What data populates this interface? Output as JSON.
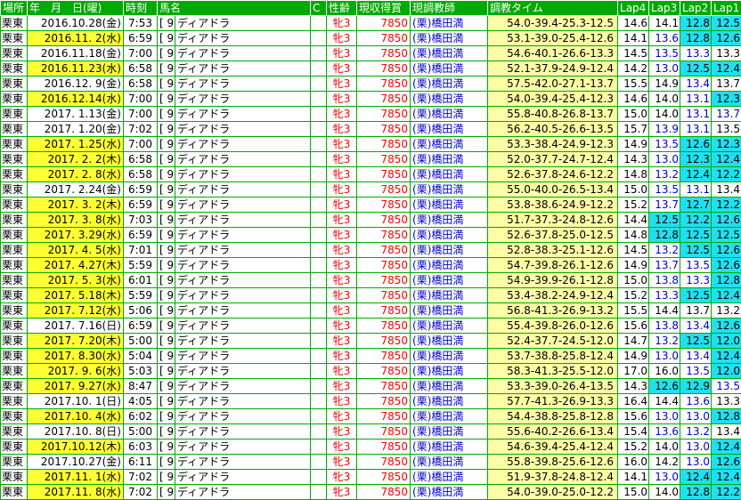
{
  "headers": {
    "place": "場所",
    "date": "年　月　日(曜)",
    "time": "時刻",
    "horse": "馬名",
    "c": "C",
    "sex_age": "性齢",
    "prize": "現収得賞",
    "trainer": "現調教師",
    "train_time": "調教タイム",
    "lap4": "Lap4",
    "lap3": "Lap3",
    "lap2": "Lap2",
    "lap1": "Lap1"
  },
  "colors": {
    "header_bg": "#00aa00",
    "weekday_highlight": "#ffff33",
    "lap_highlight": "#20e0f0",
    "train_bg": "#fdfca7",
    "red_text": "#ff0000",
    "blue_text": "#0000cc"
  },
  "rows": [
    {
      "place": "栗東",
      "date": "2016.10.28(金)",
      "date_hl": false,
      "time": "7:53",
      "num": "[ 9]",
      "horse": "ディアドラ",
      "sex": "牝3",
      "prize": "7850",
      "trainer": "(栗)橋田満",
      "train": "54.0-39.4-25.3-12.5",
      "lap4": "14.6",
      "lap3": "14.1",
      "lap2": "12.8",
      "lap1": "12.5",
      "hl4": false,
      "hl3": false,
      "hl2": true,
      "hl1": true,
      "b4": false,
      "b3": false,
      "b2": false,
      "b1": false
    },
    {
      "place": "栗東",
      "date": "2016.11. 2(水)",
      "date_hl": true,
      "time": "6:59",
      "num": "[ 9]",
      "horse": "ディアドラ",
      "sex": "牝3",
      "prize": "7850",
      "trainer": "(栗)橋田満",
      "train": "53.1-39.0-25.4-12.6",
      "lap4": "14.1",
      "lap3": "13.6",
      "lap2": "12.8",
      "lap1": "12.6",
      "hl4": false,
      "hl3": false,
      "hl2": true,
      "hl1": true,
      "b4": false,
      "b3": true,
      "b2": false,
      "b1": false
    },
    {
      "place": "栗東",
      "date": "2016.11.18(金)",
      "date_hl": false,
      "time": "7:00",
      "num": "[ 9]",
      "horse": "ディアドラ",
      "sex": "牝3",
      "prize": "7850",
      "trainer": "(栗)橋田満",
      "train": "54.6-40.1-26.6-13.3",
      "lap4": "14.5",
      "lap3": "13.5",
      "lap2": "13.3",
      "lap1": "13.3",
      "hl4": false,
      "hl3": false,
      "hl2": false,
      "hl1": false,
      "b4": false,
      "b3": true,
      "b2": true,
      "b1": false
    },
    {
      "place": "栗東",
      "date": "2016.11.23(水)",
      "date_hl": true,
      "time": "6:58",
      "num": "[ 9]",
      "horse": "ディアドラ",
      "sex": "牝3",
      "prize": "7850",
      "trainer": "(栗)橋田満",
      "train": "52.1-37.9-24.9-12.4",
      "lap4": "14.2",
      "lap3": "13.0",
      "lap2": "12.5",
      "lap1": "12.4",
      "hl4": false,
      "hl3": false,
      "hl2": true,
      "hl1": true,
      "b4": false,
      "b3": true,
      "b2": false,
      "b1": false
    },
    {
      "place": "栗東",
      "date": "2016.12. 9(金)",
      "date_hl": false,
      "time": "6:58",
      "num": "[ 9]",
      "horse": "ディアドラ",
      "sex": "牝3",
      "prize": "7850",
      "trainer": "(栗)橋田満",
      "train": "57.5-42.0-27.1-13.7",
      "lap4": "15.5",
      "lap3": "14.9",
      "lap2": "13.4",
      "lap1": "13.7",
      "hl4": false,
      "hl3": false,
      "hl2": false,
      "hl1": false,
      "b4": false,
      "b3": false,
      "b2": true,
      "b1": false
    },
    {
      "place": "栗東",
      "date": "2016.12.14(水)",
      "date_hl": true,
      "time": "7:00",
      "num": "[ 9]",
      "horse": "ディアドラ",
      "sex": "牝3",
      "prize": "7850",
      "trainer": "(栗)橋田満",
      "train": "54.0-39.4-25.4-12.3",
      "lap4": "14.6",
      "lap3": "14.0",
      "lap2": "13.1",
      "lap1": "12.3",
      "hl4": false,
      "hl3": false,
      "hl2": false,
      "hl1": true,
      "b4": false,
      "b3": false,
      "b2": true,
      "b1": false
    },
    {
      "place": "栗東",
      "date": "2017. 1.13(金)",
      "date_hl": false,
      "time": "7:00",
      "num": "[ 9]",
      "horse": "ディアドラ",
      "sex": "牝3",
      "prize": "7850",
      "trainer": "(栗)橋田満",
      "train": "55.8-40.8-26.8-13.7",
      "lap4": "15.0",
      "lap3": "14.0",
      "lap2": "13.1",
      "lap1": "13.7",
      "hl4": false,
      "hl3": false,
      "hl2": false,
      "hl1": false,
      "b4": false,
      "b3": false,
      "b2": true,
      "b1": true
    },
    {
      "place": "栗東",
      "date": "2017. 1.20(金)",
      "date_hl": false,
      "time": "7:02",
      "num": "[ 9]",
      "horse": "ディアドラ",
      "sex": "牝3",
      "prize": "7850",
      "trainer": "(栗)橋田満",
      "train": "56.2-40.5-26.6-13.5",
      "lap4": "15.7",
      "lap3": "13.9",
      "lap2": "13.1",
      "lap1": "13.5",
      "hl4": false,
      "hl3": false,
      "hl2": false,
      "hl1": false,
      "b4": false,
      "b3": true,
      "b2": true,
      "b1": false
    },
    {
      "place": "栗東",
      "date": "2017. 1.25(水)",
      "date_hl": true,
      "time": "7:00",
      "num": "[ 9]",
      "horse": "ディアドラ",
      "sex": "牝3",
      "prize": "7850",
      "trainer": "(栗)橋田満",
      "train": "53.3-38.4-24.9-12.3",
      "lap4": "14.9",
      "lap3": "13.5",
      "lap2": "12.6",
      "lap1": "12.3",
      "hl4": false,
      "hl3": false,
      "hl2": true,
      "hl1": true,
      "b4": false,
      "b3": true,
      "b2": false,
      "b1": false
    },
    {
      "place": "栗東",
      "date": "2017. 2. 2(木)",
      "date_hl": true,
      "time": "6:58",
      "num": "[ 9]",
      "horse": "ディアドラ",
      "sex": "牝3",
      "prize": "7850",
      "trainer": "(栗)橋田満",
      "train": "52.0-37.7-24.7-12.4",
      "lap4": "14.3",
      "lap3": "13.0",
      "lap2": "12.3",
      "lap1": "12.4",
      "hl4": false,
      "hl3": false,
      "hl2": true,
      "hl1": true,
      "b4": false,
      "b3": true,
      "b2": false,
      "b1": false
    },
    {
      "place": "栗東",
      "date": "2017. 2. 8(水)",
      "date_hl": true,
      "time": "6:58",
      "num": "[ 9]",
      "horse": "ディアドラ",
      "sex": "牝3",
      "prize": "7850",
      "trainer": "(栗)橋田満",
      "train": "52.6-37.8-24.6-12.2",
      "lap4": "14.8",
      "lap3": "13.2",
      "lap2": "12.4",
      "lap1": "12.2",
      "hl4": false,
      "hl3": false,
      "hl2": true,
      "hl1": true,
      "b4": false,
      "b3": true,
      "b2": false,
      "b1": false
    },
    {
      "place": "栗東",
      "date": "2017. 2.24(金)",
      "date_hl": false,
      "time": "6:59",
      "num": "[ 9]",
      "horse": "ディアドラ",
      "sex": "牝3",
      "prize": "7850",
      "trainer": "(栗)橋田満",
      "train": "55.0-40.0-26.5-13.4",
      "lap4": "15.0",
      "lap3": "13.5",
      "lap2": "13.1",
      "lap1": "13.4",
      "hl4": false,
      "hl3": false,
      "hl2": false,
      "hl1": false,
      "b4": false,
      "b3": true,
      "b2": true,
      "b1": false
    },
    {
      "place": "栗東",
      "date": "2017. 3. 2(木)",
      "date_hl": true,
      "time": "6:59",
      "num": "[ 9]",
      "horse": "ディアドラ",
      "sex": "牝3",
      "prize": "7850",
      "trainer": "(栗)橋田満",
      "train": "53.8-38.6-24.9-12.2",
      "lap4": "15.2",
      "lap3": "13.7",
      "lap2": "12.7",
      "lap1": "12.2",
      "hl4": false,
      "hl3": false,
      "hl2": true,
      "hl1": true,
      "b4": false,
      "b3": true,
      "b2": false,
      "b1": false
    },
    {
      "place": "栗東",
      "date": "2017. 3. 8(水)",
      "date_hl": true,
      "time": "7:03",
      "num": "[ 9]",
      "horse": "ディアドラ",
      "sex": "牝3",
      "prize": "7850",
      "trainer": "(栗)橋田満",
      "train": "51.7-37.3-24.8-12.6",
      "lap4": "14.4",
      "lap3": "12.5",
      "lap2": "12.2",
      "lap1": "12.6",
      "hl4": false,
      "hl3": true,
      "hl2": true,
      "hl1": true,
      "b4": false,
      "b3": false,
      "b2": false,
      "b1": false
    },
    {
      "place": "栗東",
      "date": "2017. 3.29(水)",
      "date_hl": true,
      "time": "6:59",
      "num": "[ 9]",
      "horse": "ディアドラ",
      "sex": "牝3",
      "prize": "7850",
      "trainer": "(栗)橋田満",
      "train": "52.6-37.8-25.0-12.5",
      "lap4": "14.8",
      "lap3": "12.8",
      "lap2": "12.5",
      "lap1": "12.5",
      "hl4": false,
      "hl3": true,
      "hl2": true,
      "hl1": true,
      "b4": false,
      "b3": false,
      "b2": false,
      "b1": false
    },
    {
      "place": "栗東",
      "date": "2017. 4. 5(水)",
      "date_hl": true,
      "time": "7:01",
      "num": "[ 9]",
      "horse": "ディアドラ",
      "sex": "牝3",
      "prize": "7850",
      "trainer": "(栗)橋田満",
      "train": "52.8-38.3-25.1-12.6",
      "lap4": "14.5",
      "lap3": "13.2",
      "lap2": "12.5",
      "lap1": "12.6",
      "hl4": false,
      "hl3": false,
      "hl2": true,
      "hl1": true,
      "b4": false,
      "b3": true,
      "b2": false,
      "b1": false
    },
    {
      "place": "栗東",
      "date": "2017. 4.27(木)",
      "date_hl": true,
      "time": "5:59",
      "num": "[ 9]",
      "horse": "ディアドラ",
      "sex": "牝3",
      "prize": "7850",
      "trainer": "(栗)橋田満",
      "train": "54.7-39.8-26.1-12.6",
      "lap4": "14.9",
      "lap3": "13.7",
      "lap2": "13.5",
      "lap1": "12.6",
      "hl4": false,
      "hl3": false,
      "hl2": false,
      "hl1": true,
      "b4": false,
      "b3": true,
      "b2": true,
      "b1": false
    },
    {
      "place": "栗東",
      "date": "2017. 5. 3(水)",
      "date_hl": true,
      "time": "6:01",
      "num": "[ 9]",
      "horse": "ディアドラ",
      "sex": "牝3",
      "prize": "7850",
      "trainer": "(栗)橋田満",
      "train": "54.9-39.9-26.1-12.8",
      "lap4": "15.0",
      "lap3": "13.8",
      "lap2": "13.3",
      "lap1": "12.8",
      "hl4": false,
      "hl3": false,
      "hl2": false,
      "hl1": true,
      "b4": false,
      "b3": true,
      "b2": true,
      "b1": false
    },
    {
      "place": "栗東",
      "date": "2017. 5.18(木)",
      "date_hl": true,
      "time": "5:59",
      "num": "[ 9]",
      "horse": "ディアドラ",
      "sex": "牝3",
      "prize": "7850",
      "trainer": "(栗)橋田満",
      "train": "53.4-38.2-24.9-12.4",
      "lap4": "15.2",
      "lap3": "13.3",
      "lap2": "12.5",
      "lap1": "12.4",
      "hl4": false,
      "hl3": false,
      "hl2": true,
      "hl1": true,
      "b4": false,
      "b3": true,
      "b2": false,
      "b1": false
    },
    {
      "place": "栗東",
      "date": "2017. 7.12(水)",
      "date_hl": true,
      "time": "5:06",
      "num": "[ 9]",
      "horse": "ディアドラ",
      "sex": "牝3",
      "prize": "7850",
      "trainer": "(栗)橋田満",
      "train": "56.8-41.3-26.9-13.2",
      "lap4": "15.5",
      "lap3": "14.4",
      "lap2": "13.7",
      "lap1": "13.2",
      "hl4": false,
      "hl3": false,
      "hl2": false,
      "hl1": false,
      "b4": false,
      "b3": false,
      "b2": false,
      "b1": false
    },
    {
      "place": "栗東",
      "date": "2017. 7.16(日)",
      "date_hl": false,
      "time": "6:59",
      "num": "[ 9]",
      "horse": "ディアドラ",
      "sex": "牝3",
      "prize": "7850",
      "trainer": "(栗)橋田満",
      "train": "55.4-39.8-26.0-12.6",
      "lap4": "15.6",
      "lap3": "13.8",
      "lap2": "13.4",
      "lap1": "12.6",
      "hl4": false,
      "hl3": false,
      "hl2": false,
      "hl1": true,
      "b4": false,
      "b3": true,
      "b2": true,
      "b1": false
    },
    {
      "place": "栗東",
      "date": "2017. 7.20(木)",
      "date_hl": true,
      "time": "5:00",
      "num": "[ 9]",
      "horse": "ディアドラ",
      "sex": "牝3",
      "prize": "7850",
      "trainer": "(栗)橋田満",
      "train": "52.4-37.7-24.5-12.0",
      "lap4": "14.7",
      "lap3": "13.2",
      "lap2": "12.5",
      "lap1": "12.0",
      "hl4": false,
      "hl3": false,
      "hl2": true,
      "hl1": true,
      "b4": false,
      "b3": true,
      "b2": false,
      "b1": false
    },
    {
      "place": "栗東",
      "date": "2017. 8.30(水)",
      "date_hl": true,
      "time": "5:04",
      "num": "[ 9]",
      "horse": "ディアドラ",
      "sex": "牝3",
      "prize": "7850",
      "trainer": "(栗)橋田満",
      "train": "53.7-38.8-25.8-12.4",
      "lap4": "14.9",
      "lap3": "13.0",
      "lap2": "13.4",
      "lap1": "12.4",
      "hl4": false,
      "hl3": false,
      "hl2": false,
      "hl1": true,
      "b4": false,
      "b3": true,
      "b2": true,
      "b1": false
    },
    {
      "place": "栗東",
      "date": "2017. 9. 6(水)",
      "date_hl": true,
      "time": "5:03",
      "num": "[ 9]",
      "horse": "ディアドラ",
      "sex": "牝3",
      "prize": "7850",
      "trainer": "(栗)橋田満",
      "train": "58.3-41.3-25.5-12.0",
      "lap4": "17.0",
      "lap3": "16.0",
      "lap2": "13.5",
      "lap1": "12.0",
      "hl4": false,
      "hl3": false,
      "hl2": false,
      "hl1": true,
      "b4": false,
      "b3": false,
      "b2": true,
      "b1": false
    },
    {
      "place": "栗東",
      "date": "2017. 9.27(水)",
      "date_hl": true,
      "time": "8:47",
      "num": "[ 9]",
      "horse": "ディアドラ",
      "sex": "牝3",
      "prize": "7850",
      "trainer": "(栗)橋田満",
      "train": "53.3-39.0-26.4-13.5",
      "lap4": "14.3",
      "lap3": "12.6",
      "lap2": "12.9",
      "lap1": "13.5",
      "hl4": false,
      "hl3": true,
      "hl2": true,
      "hl1": false,
      "b4": false,
      "b3": false,
      "b2": false,
      "b1": true
    },
    {
      "place": "栗東",
      "date": "2017.10. 1(日)",
      "date_hl": false,
      "time": "4:05",
      "num": "[ 9]",
      "horse": "ディアドラ",
      "sex": "牝3",
      "prize": "7850",
      "trainer": "(栗)橋田満",
      "train": "57.7-41.3-26.9-13.3",
      "lap4": "16.4",
      "lap3": "14.4",
      "lap2": "13.6",
      "lap1": "13.3",
      "hl4": false,
      "hl3": false,
      "hl2": false,
      "hl1": false,
      "b4": false,
      "b3": false,
      "b2": true,
      "b1": false
    },
    {
      "place": "栗東",
      "date": "2017.10. 4(水)",
      "date_hl": true,
      "time": "6:02",
      "num": "[ 9]",
      "horse": "ディアドラ",
      "sex": "牝3",
      "prize": "7850",
      "trainer": "(栗)橋田満",
      "train": "54.4-38.8-25.8-12.8",
      "lap4": "15.6",
      "lap3": "13.0",
      "lap2": "13.0",
      "lap1": "12.8",
      "hl4": false,
      "hl3": false,
      "hl2": false,
      "hl1": true,
      "b4": false,
      "b3": true,
      "b2": true,
      "b1": false
    },
    {
      "place": "栗東",
      "date": "2017.10. 8(日)",
      "date_hl": false,
      "time": "5:00",
      "num": "[ 9]",
      "horse": "ディアドラ",
      "sex": "牝3",
      "prize": "7850",
      "trainer": "(栗)橋田満",
      "train": "55.6-40.2-26.6-13.4",
      "lap4": "15.4",
      "lap3": "13.6",
      "lap2": "13.2",
      "lap1": "13.4",
      "hl4": false,
      "hl3": false,
      "hl2": false,
      "hl1": false,
      "b4": false,
      "b3": true,
      "b2": true,
      "b1": false
    },
    {
      "place": "栗東",
      "date": "2017.10.12(木)",
      "date_hl": true,
      "time": "6:03",
      "num": "[ 9]",
      "horse": "ディアドラ",
      "sex": "牝3",
      "prize": "7850",
      "trainer": "(栗)橋田満",
      "train": "54.6-39.4-25.4-12.4",
      "lap4": "15.2",
      "lap3": "14.0",
      "lap2": "13.0",
      "lap1": "12.4",
      "hl4": false,
      "hl3": false,
      "hl2": false,
      "hl1": true,
      "b4": false,
      "b3": false,
      "b2": true,
      "b1": false
    },
    {
      "place": "栗東",
      "date": "2017.10.27(金)",
      "date_hl": false,
      "time": "6:11",
      "num": "[ 9]",
      "horse": "ディアドラ",
      "sex": "牝3",
      "prize": "7850",
      "trainer": "(栗)橋田満",
      "train": "55.8-39.8-25.6-12.6",
      "lap4": "16.0",
      "lap3": "14.2",
      "lap2": "13.0",
      "lap1": "12.6",
      "hl4": false,
      "hl3": false,
      "hl2": false,
      "hl1": true,
      "b4": false,
      "b3": false,
      "b2": true,
      "b1": false
    },
    {
      "place": "栗東",
      "date": "2017.11. 1(水)",
      "date_hl": true,
      "time": "7:02",
      "num": "[ 9]",
      "horse": "ディアドラ",
      "sex": "牝3",
      "prize": "7850",
      "trainer": "(栗)橋田満",
      "train": "51.9-37.8-24.8-12.4",
      "lap4": "14.1",
      "lap3": "13.0",
      "lap2": "12.4",
      "lap1": "12.4",
      "hl4": false,
      "hl3": false,
      "hl2": true,
      "hl1": true,
      "b4": false,
      "b3": true,
      "b2": false,
      "b1": false
    },
    {
      "place": "栗東",
      "date": "2017.11. 8(水)",
      "date_hl": true,
      "time": "7:02",
      "num": "[ 9]",
      "horse": "ディアドラ",
      "sex": "牝3",
      "prize": "7850",
      "trainer": "(栗)橋田満",
      "train": "54.0-39.0-25.0-12.2",
      "lap4": "15.0",
      "lap3": "14.0",
      "lap2": "12.8",
      "lap1": "12.2",
      "hl4": false,
      "hl3": false,
      "hl2": true,
      "hl1": true,
      "b4": false,
      "b3": false,
      "b2": false,
      "b1": false
    }
  ]
}
